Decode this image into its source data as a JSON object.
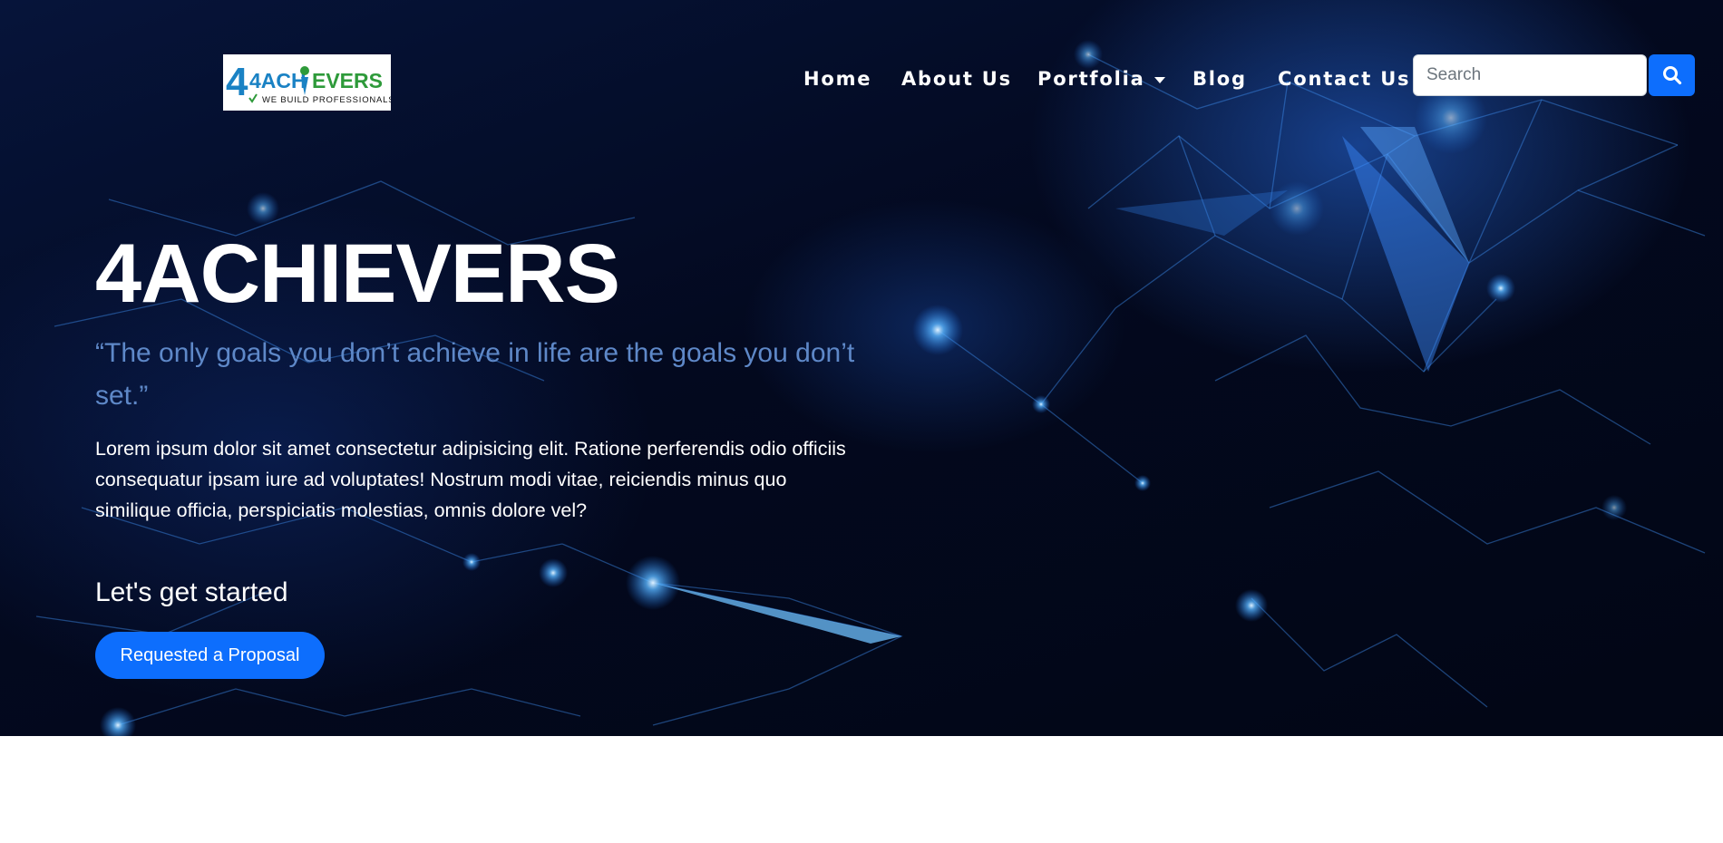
{
  "brand": {
    "logo_text_prefix": "4ACH",
    "logo_text_suffix": "EVERS",
    "logo_tagline": "We Build Professionals",
    "colors": {
      "blue": "#1a82c4",
      "green": "#2e9a3a"
    }
  },
  "nav": {
    "items": [
      {
        "label": "Home"
      },
      {
        "label": "About Us"
      },
      {
        "label": "Portfolia",
        "has_dropdown": true
      },
      {
        "label": "Blog"
      },
      {
        "label": "Contact Us"
      }
    ]
  },
  "search": {
    "placeholder": "Search",
    "button_icon": "search-icon"
  },
  "hero": {
    "title": "4ACHIEVERS",
    "quote": "“The only goals you don’t achieve in life are the goals you don’t set.”",
    "text": "Lorem ipsum dolor sit amet consectetur adipisicing elit. Ratione perferendis odio officiis consequatur ipsam iure ad voluptates! Nostrum modi vitae, reiciendis minus quo similique officia, perspiciatis molestias, omnis dolore vel?",
    "cta_heading": "Let's get started",
    "cta_button": "Requested a Proposal"
  },
  "colors": {
    "primary": "#0d6efd",
    "quote": "#5e88c8",
    "hero_background": "#03091f"
  }
}
